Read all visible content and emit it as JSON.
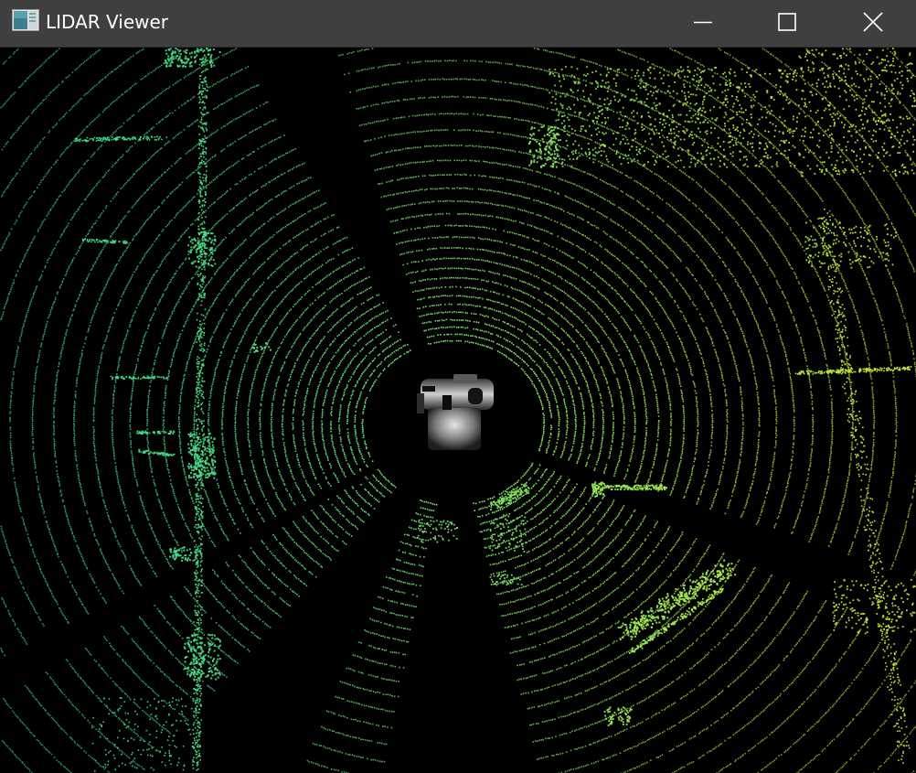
{
  "window": {
    "title": "LIDAR Viewer",
    "app_icon": "lidar-viewer-icon",
    "controls": {
      "minimize_icon": "minimize-icon",
      "maximize_icon": "maximize-icon",
      "close_icon": "close-icon"
    }
  },
  "viewer": {
    "background_color": "#000000",
    "near_point_color": "#3fdc8f",
    "far_point_color": "#c6e83a",
    "vehicle_color": "#d8d8d8",
    "vehicle_icon": "ego-vehicle-model"
  }
}
